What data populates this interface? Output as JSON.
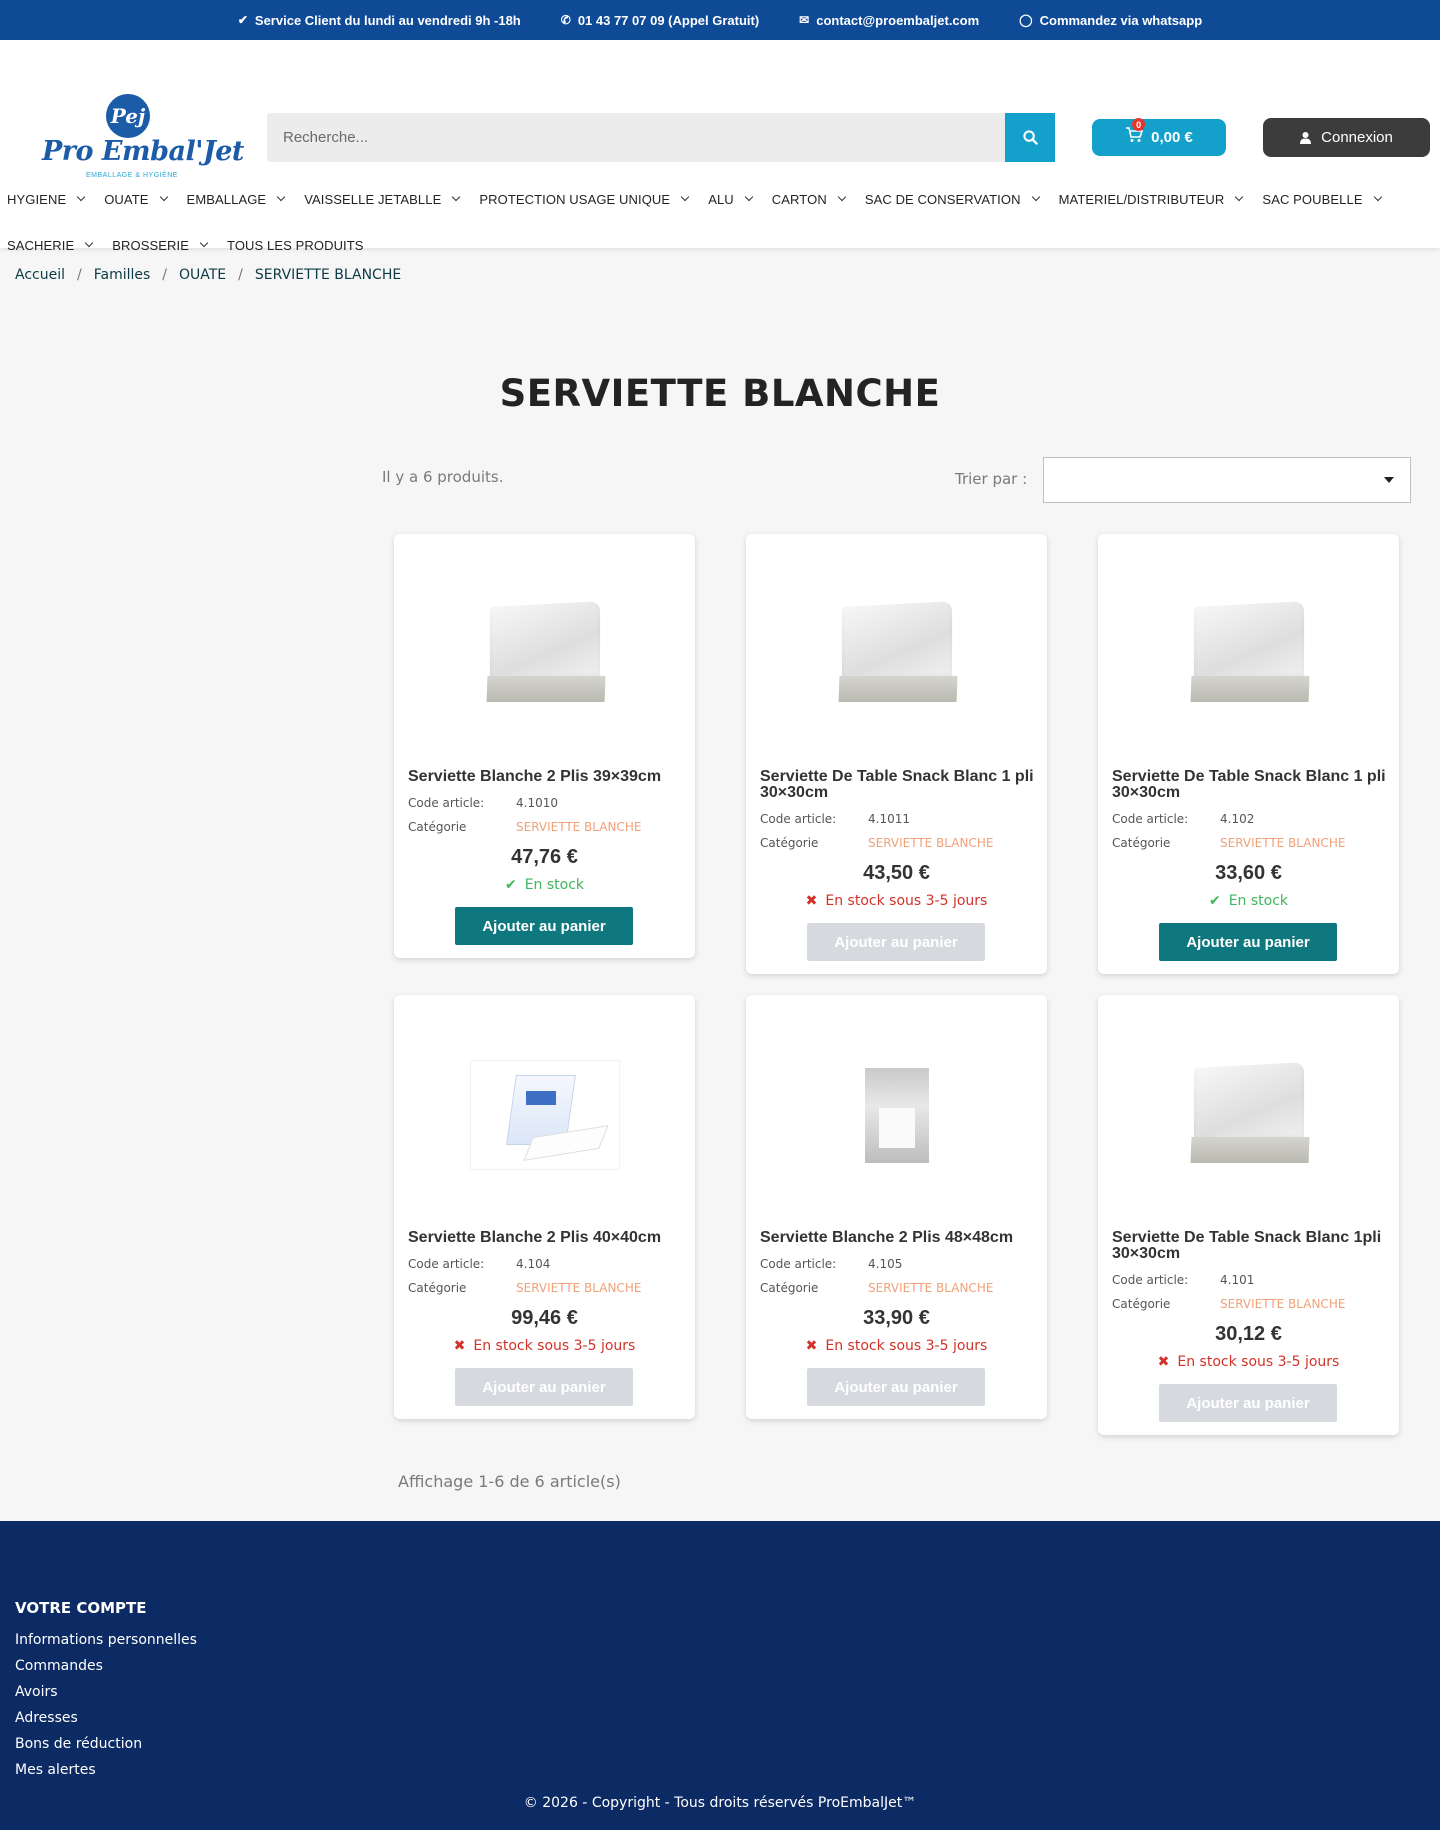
{
  "topbar": {
    "service": "Service Client du lundi au vendredi 9h -18h",
    "phone": "01 43 77 07 09 (Appel Gratuit)",
    "email": "contact@proembaljet.com",
    "whatsapp": "Commandez via whatsapp"
  },
  "header": {
    "logo_mark": "Pej",
    "logo_text": "Pro Embal'Jet",
    "logo_sub": "EMBALLAGE & HYGIÈNE",
    "search_placeholder": "Recherche...",
    "cart_count": "0",
    "cart_total": "0,00 €",
    "login_label": "Connexion"
  },
  "nav": {
    "row1": [
      "HYGIENE",
      "OUATE",
      "EMBALLAGE",
      "VAISSELLE JETABLLE",
      "PROTECTION USAGE UNIQUE",
      "ALU",
      "CARTON",
      "SAC DE CONSERVATION",
      "MATERIEL/DISTRIBUTEUR",
      "SAC POUBELLE"
    ],
    "row2": [
      "SACHERIE",
      "BROSSERIE"
    ],
    "all_products": "TOUS LES PRODUITS"
  },
  "breadcrumb": [
    "Accueil",
    "Familles",
    "OUATE",
    "SERVIETTE BLANCHE"
  ],
  "page": {
    "title": "SERVIETTE BLANCHE",
    "count": "Il y a 6 produits.",
    "sort_label": "Trier par :",
    "pagination": "Affichage 1-6 de 6 article(s)"
  },
  "labels": {
    "code": "Code article:",
    "category": "Catégorie"
  },
  "products": [
    {
      "name": "Serviette Blanche 2 Plis 39×39cm",
      "code": "4.1010",
      "category": "SERVIETTE BLANCHE",
      "price": "47,76 €",
      "stock": "En stock",
      "in_stock": true,
      "button": "Ajouter au panier"
    },
    {
      "name": "Serviette De Table Snack Blanc 1 pli 30×30cm",
      "code": "4.1011",
      "category": "SERVIETTE BLANCHE",
      "price": "43,50 €",
      "stock": "En stock sous 3-5 jours",
      "in_stock": false,
      "button": "Ajouter au panier"
    },
    {
      "name": "Serviette De Table Snack Blanc 1 pli 30×30cm",
      "code": "4.102",
      "category": "SERVIETTE BLANCHE",
      "price": "33,60 €",
      "stock": "En stock",
      "in_stock": true,
      "button": "Ajouter au panier"
    },
    {
      "name": "Serviette Blanche 2 Plis 40×40cm",
      "code": "4.104",
      "category": "SERVIETTE BLANCHE",
      "price": "99,46 €",
      "stock": "En stock sous 3-5 jours",
      "in_stock": false,
      "button": "Ajouter au panier"
    },
    {
      "name": "Serviette Blanche 2 Plis 48×48cm",
      "code": "4.105",
      "category": "SERVIETTE BLANCHE",
      "price": "33,90 €",
      "stock": "En stock sous 3-5 jours",
      "in_stock": false,
      "button": "Ajouter au panier"
    },
    {
      "name": "Serviette De Table Snack Blanc 1pli 30×30cm",
      "code": "4.101",
      "category": "SERVIETTE BLANCHE",
      "price": "30,12 €",
      "stock": "En stock sous 3-5 jours",
      "in_stock": false,
      "button": "Ajouter au panier"
    }
  ],
  "footer": {
    "title": "VOTRE COMPTE",
    "links": [
      "Informations personnelles",
      "Commandes",
      "Avoirs",
      "Adresses",
      "Bons de réduction",
      "Mes alertes"
    ],
    "copyright": "© 2026 - Copyright - Tous droits réservés ProEmbalJet™"
  },
  "colors": {
    "topbar": "#0f4a97",
    "accent": "#13a1cc",
    "add_button": "#0f787f",
    "disabled_button": "#d6d9de",
    "in_stock": "#3fb65d",
    "out_of_stock": "#d2322a",
    "footer": "#0c2a63"
  }
}
